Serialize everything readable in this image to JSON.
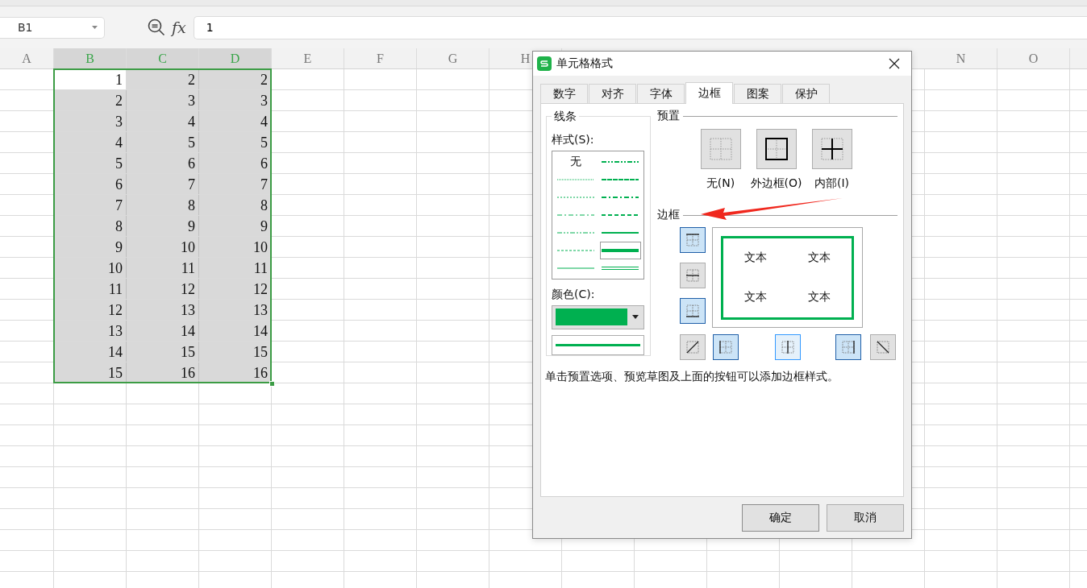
{
  "formula_bar": {
    "name_box": "B1",
    "fx_label": "fx",
    "value": "1"
  },
  "columns": [
    {
      "label": "A",
      "selected": false
    },
    {
      "label": "B",
      "selected": true
    },
    {
      "label": "C",
      "selected": true
    },
    {
      "label": "D",
      "selected": true
    },
    {
      "label": "E",
      "selected": false
    },
    {
      "label": "F",
      "selected": false
    },
    {
      "label": "G",
      "selected": false
    },
    {
      "label": "H",
      "selected": false
    },
    {
      "label": "N",
      "selected": false
    },
    {
      "label": "O",
      "selected": false
    }
  ],
  "rows": [
    [
      {
        "text": "1",
        "active": true
      },
      {
        "text": "2",
        "active": false
      },
      {
        "text": "2",
        "active": false
      }
    ],
    [
      {
        "text": "2",
        "active": false
      },
      {
        "text": "3",
        "active": false
      },
      {
        "text": "3",
        "active": false
      }
    ],
    [
      {
        "text": "3",
        "active": false
      },
      {
        "text": "4",
        "active": false
      },
      {
        "text": "4",
        "active": false
      }
    ],
    [
      {
        "text": "4",
        "active": false
      },
      {
        "text": "5",
        "active": false
      },
      {
        "text": "5",
        "active": false
      }
    ],
    [
      {
        "text": "5",
        "active": false
      },
      {
        "text": "6",
        "active": false
      },
      {
        "text": "6",
        "active": false
      }
    ],
    [
      {
        "text": "6",
        "active": false
      },
      {
        "text": "7",
        "active": false
      },
      {
        "text": "7",
        "active": false
      }
    ],
    [
      {
        "text": "7",
        "active": false
      },
      {
        "text": "8",
        "active": false
      },
      {
        "text": "8",
        "active": false
      }
    ],
    [
      {
        "text": "8",
        "active": false
      },
      {
        "text": "9",
        "active": false
      },
      {
        "text": "9",
        "active": false
      }
    ],
    [
      {
        "text": "9",
        "active": false
      },
      {
        "text": "10",
        "active": false
      },
      {
        "text": "10",
        "active": false
      }
    ],
    [
      {
        "text": "10",
        "active": false
      },
      {
        "text": "11",
        "active": false
      },
      {
        "text": "11",
        "active": false
      }
    ],
    [
      {
        "text": "11",
        "active": false
      },
      {
        "text": "12",
        "active": false
      },
      {
        "text": "12",
        "active": false
      }
    ],
    [
      {
        "text": "12",
        "active": false
      },
      {
        "text": "13",
        "active": false
      },
      {
        "text": "13",
        "active": false
      }
    ],
    [
      {
        "text": "13",
        "active": false
      },
      {
        "text": "14",
        "active": false
      },
      {
        "text": "14",
        "active": false
      }
    ],
    [
      {
        "text": "14",
        "active": false
      },
      {
        "text": "15",
        "active": false
      },
      {
        "text": "15",
        "active": false
      }
    ],
    [
      {
        "text": "15",
        "active": false
      },
      {
        "text": "16",
        "active": false
      },
      {
        "text": "16",
        "active": false
      }
    ]
  ],
  "dialog": {
    "title": "单元格格式",
    "tabs": [
      {
        "label": "数字",
        "selected": false
      },
      {
        "label": "对齐",
        "selected": false
      },
      {
        "label": "字体",
        "selected": false
      },
      {
        "label": "边框",
        "selected": true
      },
      {
        "label": "图案",
        "selected": false
      },
      {
        "label": "保护",
        "selected": false
      }
    ],
    "line_group": {
      "title": "线条",
      "style_label": "样式(S):",
      "styles": [
        {
          "kind": "none",
          "label": "无",
          "selected": false
        },
        {
          "kind": "mediumdashdotdot",
          "selected": false
        },
        {
          "kind": "hair",
          "selected": false
        },
        {
          "kind": "slantdashdot",
          "selected": false
        },
        {
          "kind": "dotted",
          "selected": false
        },
        {
          "kind": "mediumdashdot",
          "selected": false
        },
        {
          "kind": "dashdot",
          "selected": false
        },
        {
          "kind": "mediumdashed",
          "selected": false
        },
        {
          "kind": "dashdotdot",
          "selected": false
        },
        {
          "kind": "medium",
          "selected": false
        },
        {
          "kind": "dashed",
          "selected": false
        },
        {
          "kind": "thick",
          "selected": true
        },
        {
          "kind": "thin",
          "selected": false
        },
        {
          "kind": "double",
          "selected": false
        }
      ],
      "color_label": "颜色(C):",
      "color": "#00b050"
    },
    "preset_title": "预置",
    "presets": [
      {
        "kind": "none",
        "label": "无(N)"
      },
      {
        "kind": "outline",
        "label": "外边框(O)"
      },
      {
        "kind": "inside",
        "label": "内部(I)"
      }
    ],
    "border_title": "边框",
    "border_buttons": [
      {
        "kind": "top",
        "selected": true,
        "hovered": false
      },
      {
        "kind": "middle-h",
        "selected": false,
        "hovered": false
      },
      {
        "kind": "bottom",
        "selected": true,
        "hovered": false
      },
      {
        "kind": "diag-up",
        "selected": false,
        "hovered": false
      },
      {
        "kind": "left",
        "selected": true,
        "hovered": false
      },
      {
        "kind": "middle-v",
        "selected": false,
        "hovered": true
      },
      {
        "kind": "right",
        "selected": true,
        "hovered": false
      },
      {
        "kind": "diag-down",
        "selected": false,
        "hovered": false
      }
    ],
    "preview_texts": [
      "文本",
      "文本",
      "文本",
      "文本"
    ],
    "hint": "单击预置选项、预览草图及上面的按钮可以添加边框样式。",
    "buttons": [
      "确定",
      "取消"
    ]
  }
}
